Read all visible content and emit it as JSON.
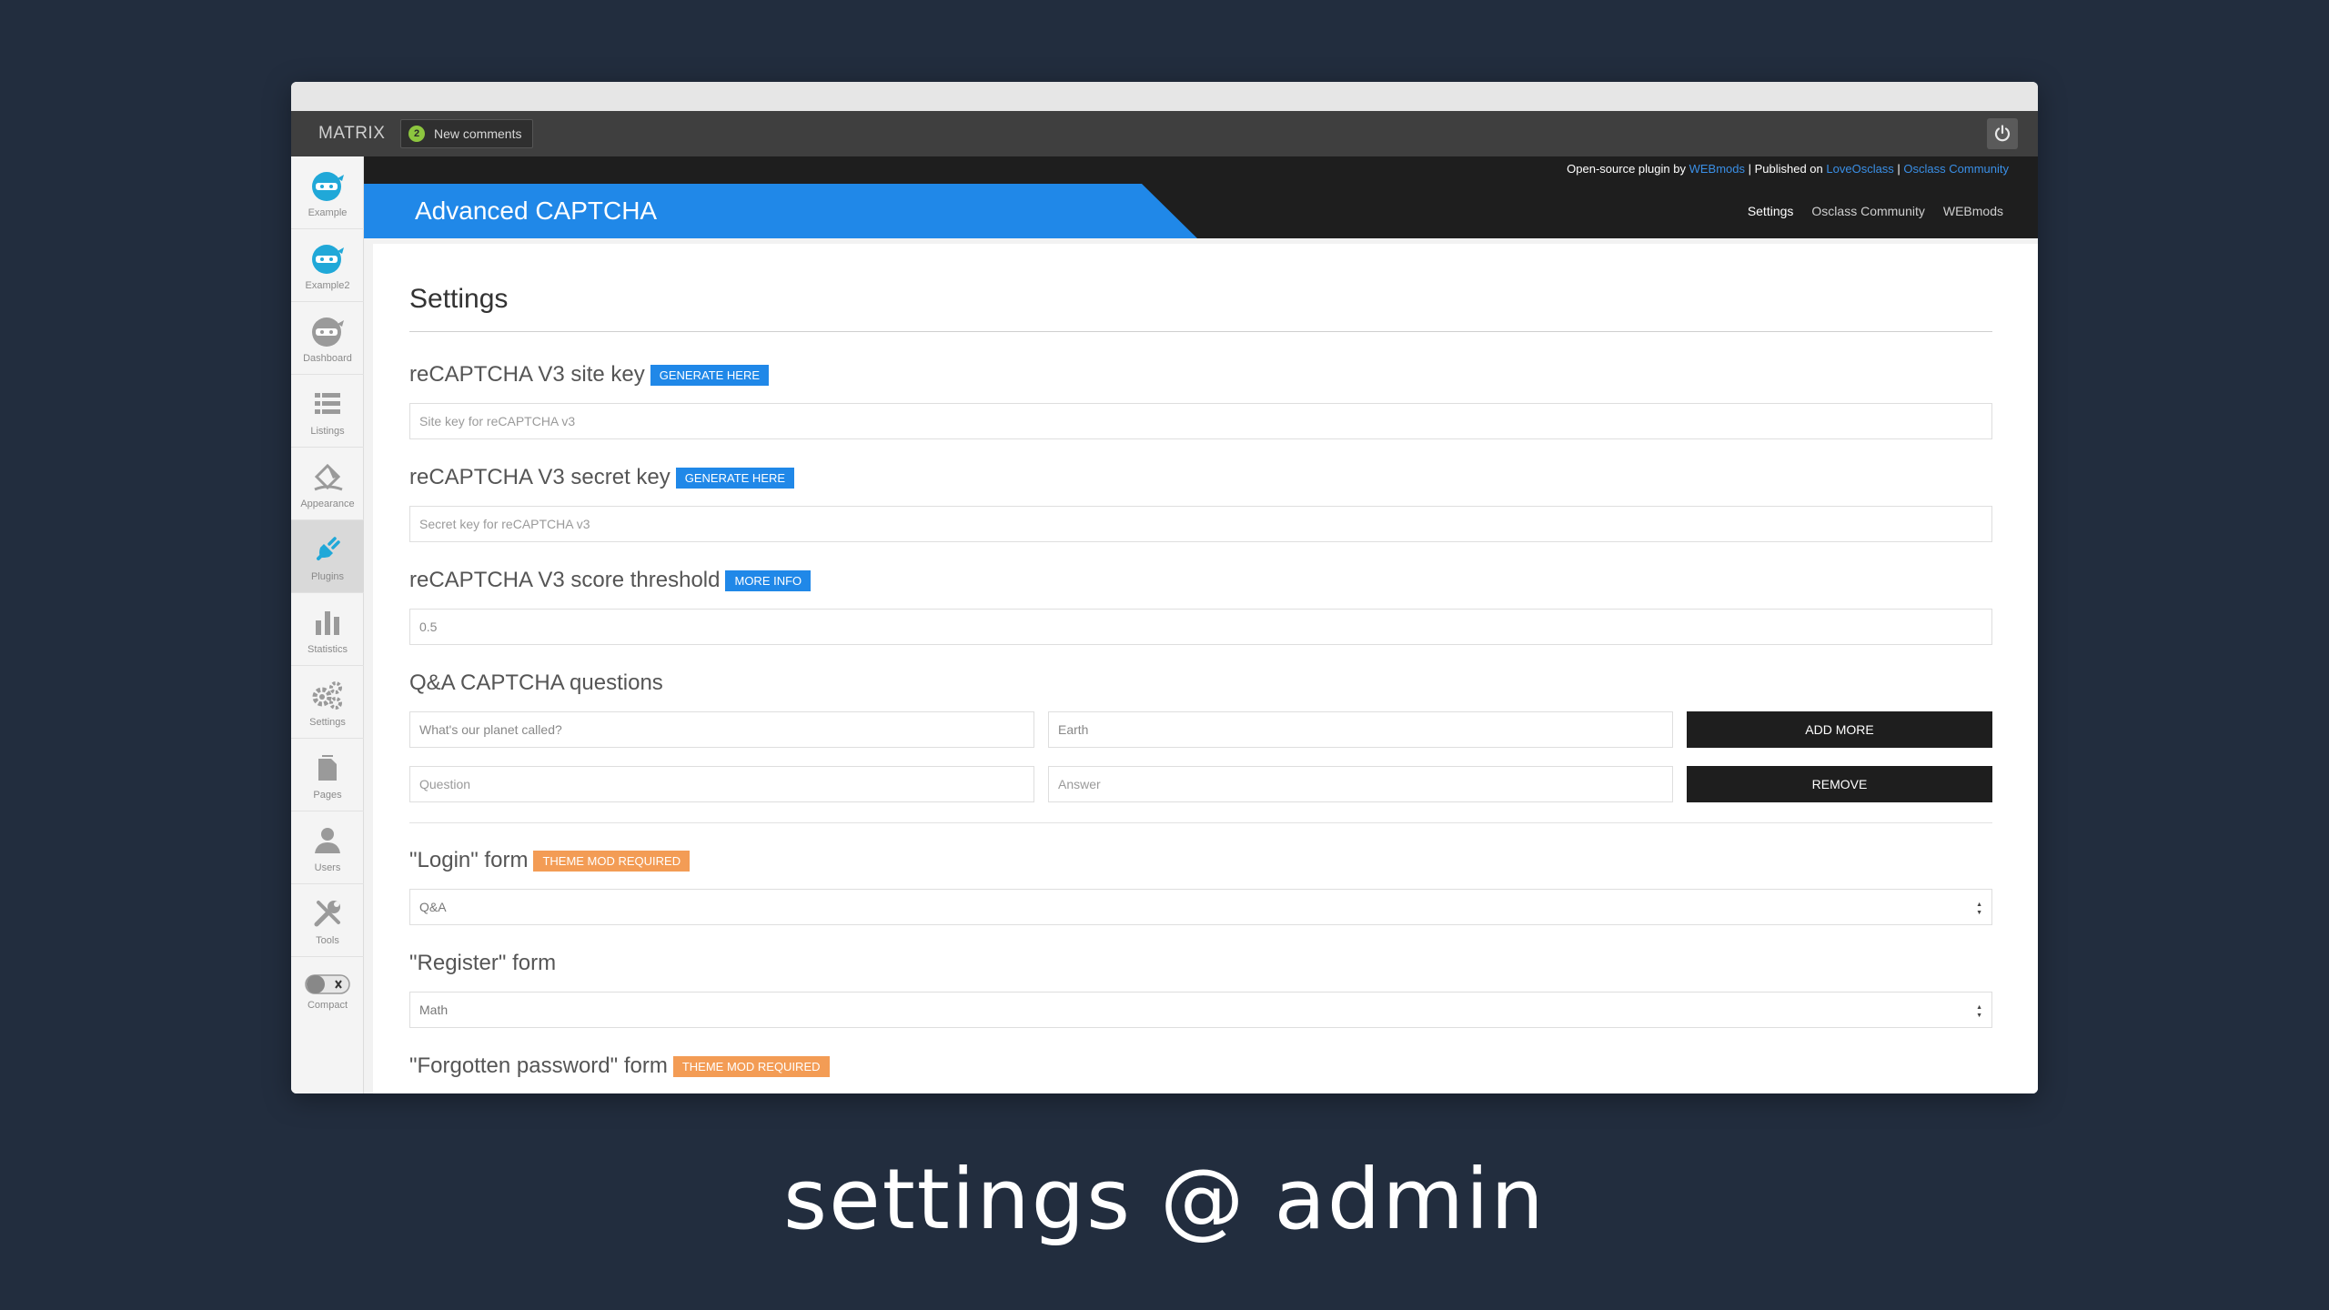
{
  "topbar": {
    "brand": "MATRIX",
    "notification_count": "2",
    "notification_label": "New comments"
  },
  "sidebar": {
    "items": [
      {
        "label": "Example",
        "icon": "ninja-icon"
      },
      {
        "label": "Example2",
        "icon": "ninja-icon"
      },
      {
        "label": "Dashboard",
        "icon": "ninja-icon"
      },
      {
        "label": "Listings",
        "icon": "list-icon"
      },
      {
        "label": "Appearance",
        "icon": "paint-icon"
      },
      {
        "label": "Plugins",
        "icon": "plug-icon"
      },
      {
        "label": "Statistics",
        "icon": "bar-chart-icon"
      },
      {
        "label": "Settings",
        "icon": "gears-icon"
      },
      {
        "label": "Pages",
        "icon": "pages-icon"
      },
      {
        "label": "Users",
        "icon": "user-icon"
      },
      {
        "label": "Tools",
        "icon": "wrench-icon"
      }
    ],
    "compact_label": "Compact"
  },
  "plugin": {
    "credit_prefix": "Open-source plugin by ",
    "credit_author": "WEBmods",
    "credit_mid": " | Published on ",
    "credit_site1": "LoveOsclass",
    "credit_sep": " | ",
    "credit_site2": "Osclass Community",
    "title": "Advanced CAPTCHA",
    "nav": [
      "Settings",
      "Osclass Community",
      "WEBmods"
    ]
  },
  "settings": {
    "heading": "Settings",
    "site_key_label": "reCAPTCHA V3 site key",
    "site_key_badge": "GENERATE HERE",
    "site_key_placeholder": "Site key for reCAPTCHA v3",
    "secret_key_label": "reCAPTCHA V3 secret key",
    "secret_key_badge": "GENERATE HERE",
    "secret_key_placeholder": "Secret key for reCAPTCHA v3",
    "threshold_label": "reCAPTCHA V3 score threshold",
    "threshold_badge": "MORE INFO",
    "threshold_value": "0.5",
    "qa_label": "Q&A CAPTCHA questions",
    "qa_rows": [
      {
        "question": "What's our planet called?",
        "answer": "Earth",
        "button": "ADD MORE"
      },
      {
        "question": "Question",
        "answer": "Answer",
        "button": "REMOVE"
      }
    ],
    "login_label": "\"Login\" form",
    "login_badge": "THEME MOD REQUIRED",
    "login_value": "Q&A",
    "register_label": "\"Register\" form",
    "register_value": "Math",
    "forgot_label": "\"Forgotten password\" form",
    "forgot_badge": "THEME MOD REQUIRED"
  },
  "caption": "settings @ admin",
  "colors": {
    "background": "#222d3e",
    "accent": "#2088e8",
    "badge_orange": "#f39c55",
    "topbar": "#3f3f3f",
    "header": "#1e1e1e"
  }
}
